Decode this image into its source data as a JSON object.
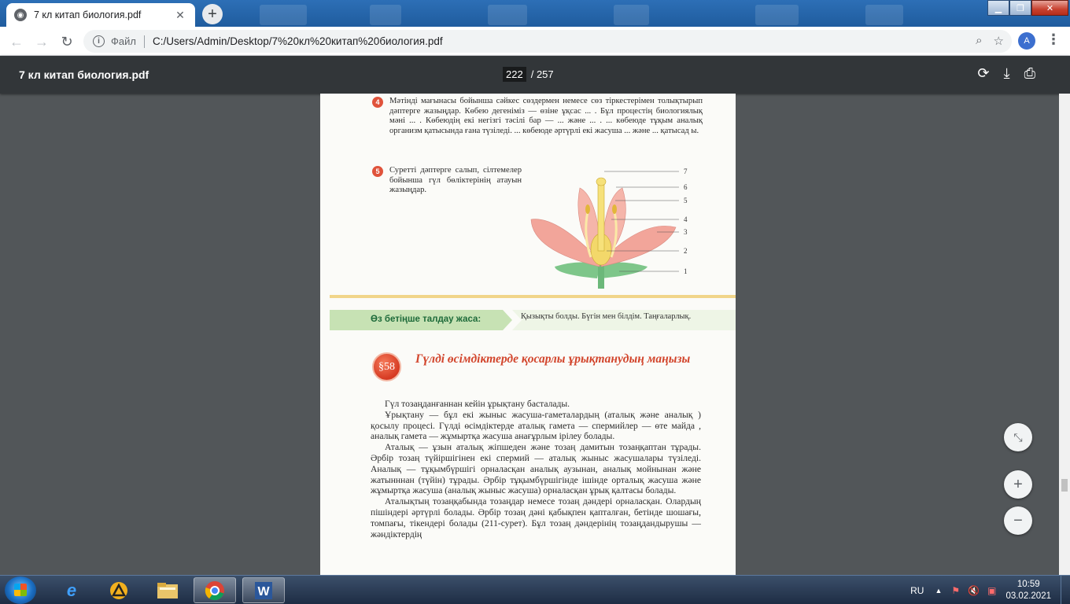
{
  "browser": {
    "tab_title": "7 кл китап биология.pdf",
    "scheme_label": "Файл",
    "url": "C:/Users/Admin/Desktop/7%20кл%20китап%20биология.pdf",
    "avatar_letter": "A"
  },
  "viewer": {
    "title": "7 кл китап биология.pdf",
    "current_page": "222",
    "page_separator": "/",
    "total_pages": "257"
  },
  "page": {
    "q4_number": "4",
    "q4_text": "Мәтінді мағынасы бойынша сәйкес сөздермен немесе сөз тіркестерімен толықтырып дәптерге жазыңдар. Көбею дегеніміз — өзіне ұқсас ... . Бұл процестің биологиялық мәні ... . Көбеюдің екі негізгі тәсілі бар — ... және ... . ... көбеюде тұқым аналық организм қатысында ғана түзіледі. ... көбеюде әртүрлі екі жасуша ... және ... қатысад ы.",
    "q5_number": "5",
    "q5_text": "Суретті дәптерге салып, сілтемелер бойынша гүл бөліктерінің атауын жазыңдар.",
    "figure_labels": [
      "7",
      "6",
      "5",
      "4",
      "3",
      "2",
      "1"
    ],
    "band_label": "Өз бетіңше талдау жаса:",
    "band_text": "Қызықты болды. Бүгін мен білдім. Таңғаларлық.",
    "section_badge": "§58",
    "heading": "Гүлді өсімдіктерде қосарлы ұрықтанудың маңызы",
    "paragraphs": [
      "Гүл тозаңданғаннан кейін ұрықтану басталады.",
      "Ұрықтану — бұл екі жыныс жасуша-гаметалардың (аталық және аналық ) қосылу процесі. Гүлді өсімдіктерде аталық гамета — спермийлер — өте майда , аналық гамета — жұмыртқа жасуша анағұрлым ірілеу болады.",
      "Аталық — ұзын аталық жіпшеден және тозаң дамитын тозаңқаптан тұрады. Әрбір тозаң түйіршігінен екі спермий — аталық жыныс жасушалары түзіледі. Аналық — тұқымбүршігі орналасқан аналық аузынан, аналық мойнынан және жатынннан (түйін) тұрады. Әрбір тұқымбүршігінде ішінде орталық жасуша және жұмыртқа жасуша (аналық жыныс жасуша) орналасқан ұрық қалтасы болады.",
      "Аталықтың тозаңқабында тозаңдар немесе тозаң дәндері орналасқан. Олардың пішіндері әртүрлі болады. Әрбір тозаң дәні қабықпен қапталған, бетінде шошағы, томпағы, тікендері болады (211-сурет). Бұл тозаң дәндерінің тозаңдандырушы — жәндіктердің"
    ]
  },
  "taskbar": {
    "lang": "RU",
    "time": "10:59",
    "date": "03.02.2021"
  }
}
